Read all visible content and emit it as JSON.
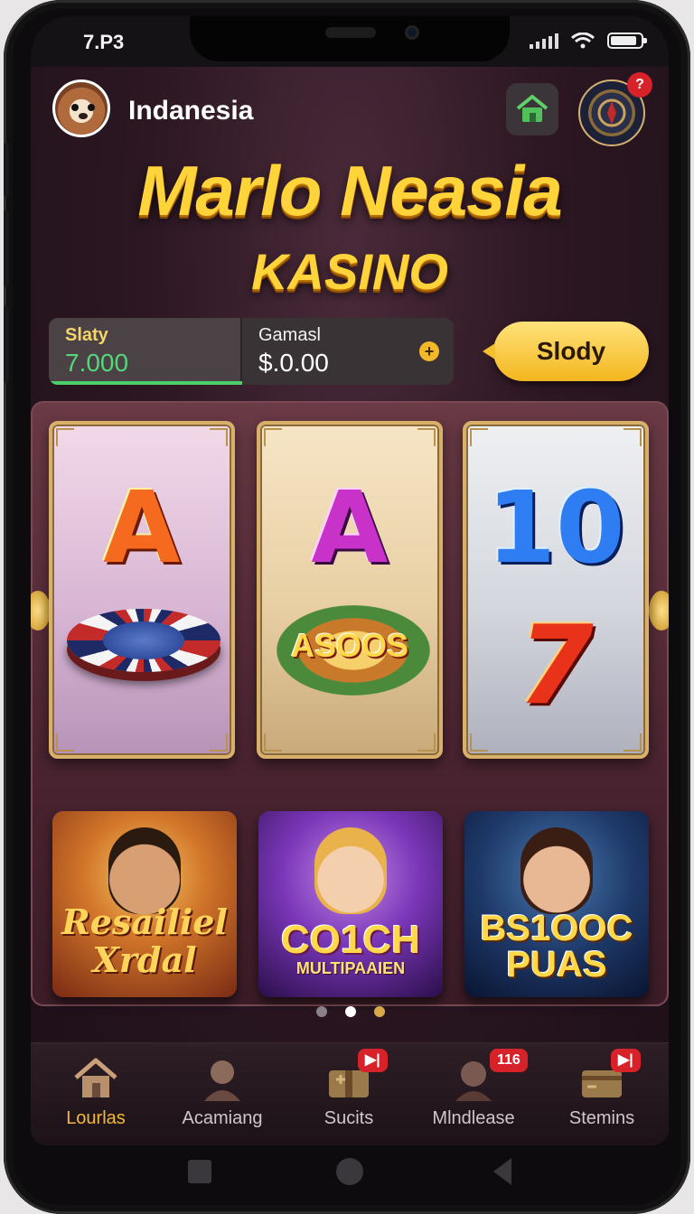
{
  "status_bar": {
    "time": "7.P3",
    "icons": [
      "signal-icon",
      "wifi-icon",
      "battery-icon"
    ]
  },
  "header": {
    "username": "Indanesia",
    "avatar_icon": "hamster-avatar",
    "home_icon": "home-icon",
    "settings_icon": "roulette-settings-icon",
    "help_badge": "?"
  },
  "title": {
    "main": "Marlo Neasia",
    "sub": "KASINO"
  },
  "balance": {
    "left_label": "Slaty",
    "left_value": "7.000",
    "right_label": "Gamasl",
    "right_value": "$.0.00",
    "add_label": "+",
    "action_button": "Slody"
  },
  "slots": [
    {
      "top": "A",
      "bottom_icon": "poker-chip-icon"
    },
    {
      "top": "A",
      "bottom_text": "ASOOS"
    },
    {
      "top": "10",
      "bottom": "7"
    }
  ],
  "games": [
    {
      "line1": "Resailiel",
      "line2": "Xrdal"
    },
    {
      "line1": "CO1CH",
      "line2": "MULTIPAAIEN"
    },
    {
      "line1": "BS1OOC",
      "line2": "PUAS"
    }
  ],
  "carousel": {
    "count": 3,
    "active_index": 1
  },
  "nav": [
    {
      "label": "Lourlas",
      "icon": "home-icon",
      "active": true
    },
    {
      "label": "Acamiang",
      "icon": "person-icon"
    },
    {
      "label": "Sucits",
      "icon": "gift-box-icon",
      "badge": "▶|"
    },
    {
      "label": "Mlndlease",
      "icon": "profile-icon",
      "badge": "116"
    },
    {
      "label": "Stemins",
      "icon": "wallet-icon",
      "badge": "▶|"
    }
  ],
  "colors": {
    "accent_gold": "#f4b83a",
    "title_gold": "#ffd43b",
    "balance_green": "#55d67a",
    "badge_red": "#d7222a"
  }
}
